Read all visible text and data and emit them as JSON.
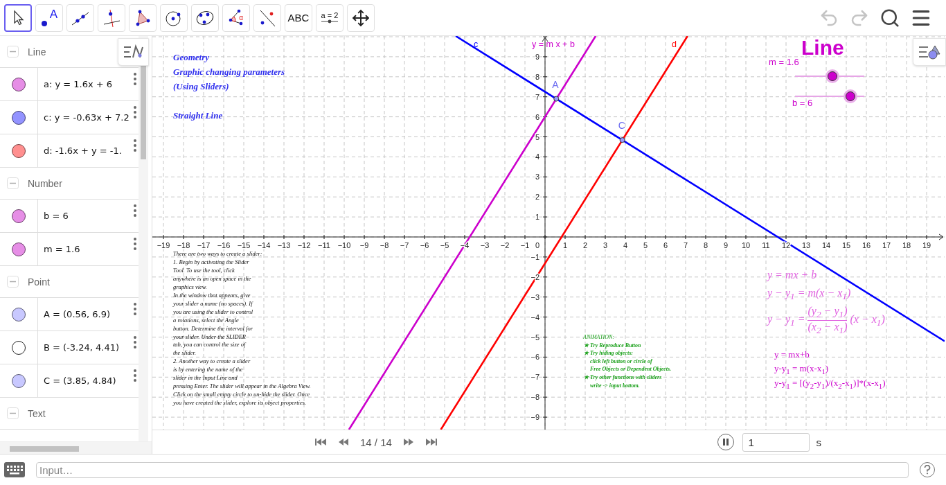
{
  "toolbar": {
    "tools": [
      {
        "kind": "move",
        "selected": true
      },
      {
        "kind": "point",
        "selected": false,
        "label": "A"
      },
      {
        "kind": "line",
        "selected": false
      },
      {
        "kind": "perpendicular",
        "selected": false
      },
      {
        "kind": "polygon",
        "selected": false
      },
      {
        "kind": "circle",
        "selected": false
      },
      {
        "kind": "conic",
        "selected": false
      },
      {
        "kind": "angle",
        "selected": false,
        "label": "α"
      },
      {
        "kind": "reflect",
        "selected": false
      },
      {
        "kind": "text",
        "selected": false,
        "label": "ABC"
      },
      {
        "kind": "slider",
        "selected": false,
        "label": "a = 2"
      },
      {
        "kind": "pan",
        "selected": false
      }
    ],
    "actions": [
      {
        "kind": "undo",
        "disabled": true
      },
      {
        "kind": "redo",
        "disabled": true
      },
      {
        "kind": "search",
        "disabled": false
      },
      {
        "kind": "menu",
        "disabled": false
      }
    ]
  },
  "algebra": {
    "groups": [
      {
        "title": "Line",
        "expanded": true,
        "items": [
          {
            "text": "a: y = 1.6x + 6",
            "color": "#e68ee6",
            "visible": true
          },
          {
            "text": "c: y = -0.63x + 7.2",
            "color": "#9393ff",
            "visible": true
          },
          {
            "text": "d: -1.6x + y = -1.",
            "color": "#ff8f8f",
            "visible": true
          }
        ]
      },
      {
        "title": "Number",
        "expanded": true,
        "items": [
          {
            "text": "b = 6",
            "color": "#e68ee6",
            "visible": true
          },
          {
            "text": "m = 1.6",
            "color": "#e68ee6",
            "visible": true
          }
        ]
      },
      {
        "title": "Point",
        "expanded": true,
        "items": [
          {
            "text": "A = (0.56, 6.9)",
            "color": "#c8c8ff",
            "visible": true
          },
          {
            "text": "B = (-3.24, 4.41)",
            "visible": false
          },
          {
            "text": "C = (3.85, 4.84)",
            "color": "#c8c8ff",
            "visible": true
          }
        ]
      },
      {
        "title": "Text",
        "expanded": true
      }
    ]
  },
  "graph": {
    "x_ticks": [
      "−19",
      "−18",
      "−17",
      "−16",
      "−15",
      "−14",
      "−13",
      "−12",
      "−11",
      "−10",
      "−9",
      "−8",
      "−7",
      "−6",
      "−5",
      "−4",
      "−3",
      "−2",
      "−1",
      "1",
      "2",
      "3",
      "4",
      "5",
      "6",
      "7",
      "8",
      "9",
      "10",
      "11",
      "12",
      "13",
      "14",
      "15",
      "16",
      "17",
      "18",
      "19"
    ],
    "y_ticks": [
      "9",
      "8",
      "7",
      "6",
      "5",
      "4",
      "3",
      "2",
      "1",
      "−1",
      "−2",
      "−3",
      "−4",
      "−5",
      "−6",
      "−7",
      "−8",
      "−9"
    ],
    "origin_label": "0",
    "lines": [
      {
        "label": "c",
        "color": "#0000ff"
      },
      {
        "label": "y = m x + b",
        "color": "#cc00cc"
      },
      {
        "label": "d",
        "color": "#ff0000"
      }
    ],
    "points": [
      {
        "label": "A"
      },
      {
        "label": "C"
      }
    ],
    "title_lines": [
      "Geometry",
      "Graphic changing parameters",
      "(Using Sliders)",
      "Straight Line"
    ],
    "instructions": [
      "There are two ways to create a slider:",
      "1. Begin by activating the Slider",
      "Tool. To use the tool, click",
      "anywhere is an open space in the",
      "graphics view.",
      "In the window that appears, give",
      "your slider a name (no spaces). If",
      "you are using the slider to control",
      "a rotations, select the Angle",
      "button. Determine the interval for",
      "your slider. Under the SLIDER",
      "tab, you can control the size of",
      "the slider.",
      "2. Another way to create a slider",
      "is by entering the name of the",
      "slider in the Input Line and",
      "pressing Enter. The slider will appear in the Algebra View.",
      "Click on the small empty circle to un-hide the slider. Once",
      "you have created the slider, explore its object properties."
    ],
    "animation_notes": [
      {
        "kind": "heading",
        "text": "ANIMATION:"
      },
      {
        "kind": "bullet",
        "text": "★ Try Reproduce Button"
      },
      {
        "kind": "bullet",
        "text": "★ Try hiding objects:"
      },
      {
        "kind": "indent",
        "text": "click left button or circle of"
      },
      {
        "kind": "indent",
        "text": "Free Objects or Dependent Objects."
      },
      {
        "kind": "bullet",
        "text": "★ Try other  functions with sliders"
      },
      {
        "kind": "indent",
        "text": "write -> input bottom."
      }
    ],
    "heading": "Line",
    "sliders": [
      {
        "label": "m = 1.6",
        "level": 0.54
      },
      {
        "label": "b = 6",
        "level": 0.8
      }
    ],
    "formulas": [
      {
        "kind": "inline",
        "text": "y = mx + b"
      },
      {
        "kind": "inline",
        "text": "y − y$_{1}$ = m(x − x$_{1}$)"
      },
      {
        "kind": "fraction",
        "left": "y − y$_{1}$ =",
        "numerator": "(y$_{2}$ − y$_{1}$)",
        "denominator": "(x$_{2}$ − x$_{1}$)",
        "right": "(x − x$_{1}$)"
      }
    ],
    "plain_formulas": [
      "y = mx+b",
      "y-y$_{1}$ = m(x-x$_{1}$)",
      "y-y$_{1}$ = [(y$_{2}$-y$_{1}$)/(x$_{2}$-x$_{1}$)]*(x-x$_{1}$)"
    ]
  },
  "playbar": {
    "buttons": [
      {
        "kind": "first"
      },
      {
        "kind": "previous"
      },
      {
        "kind": "next"
      },
      {
        "kind": "last"
      }
    ],
    "counter": "14 / 14",
    "playing": true,
    "speed": "1",
    "unit": "s"
  },
  "input_bar": {
    "placeholder": "Input…"
  }
}
